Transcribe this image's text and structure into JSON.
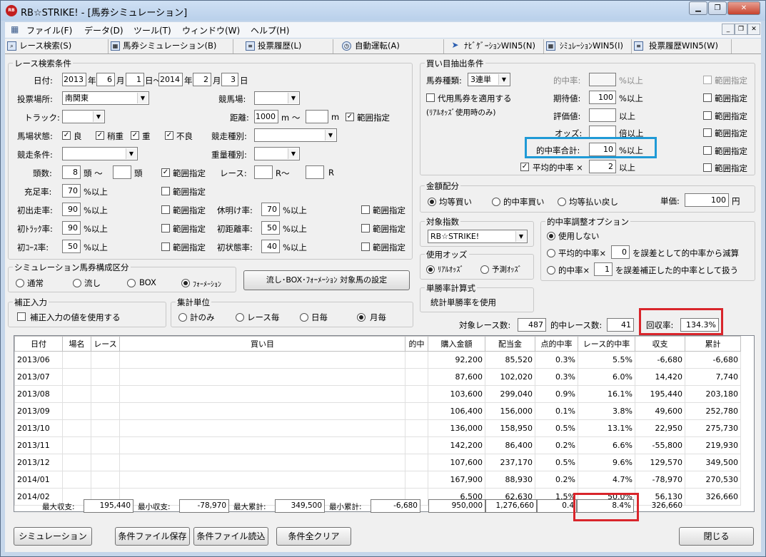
{
  "window": {
    "title": "RB☆STRIKE! - [馬券シミュレーション]",
    "icon_text": "RB"
  },
  "menu": [
    "ファイル(F)",
    "データ(D)",
    "ツール(T)",
    "ウィンドウ(W)",
    "ヘルプ(H)"
  ],
  "tabs": [
    "レース検索(S)",
    "馬券シミュレーション(B)",
    "投票履歴(L)",
    "自動運転(A)",
    "ﾅﾋﾞｹﾞｰｼｮﾝWIN5(N)",
    "ｼﾐｭﾚｰｼｮﾝWIN5(I)",
    "投票履歴WIN5(W)"
  ],
  "race": {
    "legend": "レース検索条件",
    "date_label": "日付:",
    "from_year": "2013",
    "year": "年",
    "from_month": "6",
    "month": "月",
    "from_day": "1",
    "day_range": "日〜",
    "to_year": "2014",
    "to_month": "2",
    "to_day": "3",
    "day": "日",
    "venue_label": "投票場所:",
    "venue": "南関東",
    "track_label": "競馬場:",
    "course_label": "トラック:",
    "distance_label": "距離:",
    "distance_from": "1000",
    "m_range": "m 〜",
    "m": "m",
    "range": "範囲指定",
    "condition_label": "馬場状態:",
    "good": "良",
    "slightly_heavy": "稍重",
    "heavy": "重",
    "bad": "不良",
    "race_type_label": "競走種別:",
    "race_cond_label": "競走条件:",
    "weight_label": "重量種別:",
    "heads_label": "頭数:",
    "heads_from": "8",
    "heads_range": "頭 〜",
    "heads": "頭",
    "race_label": "レース:",
    "r_range": "R〜",
    "r": "R",
    "fill_label": "充足率:",
    "fill": "70",
    "pct_over": "%以上",
    "first_run_label": "初出走率:",
    "first_run": "90",
    "rest_label": "休明け率:",
    "rest": "70",
    "first_track_label": "初ﾄﾗｯｸ率:",
    "first_track": "90",
    "first_dist_label": "初距離率:",
    "first_dist": "50",
    "first_course_label": "初ｺｰｽ率:",
    "first_course": "50",
    "first_state_label": "初状態率:",
    "first_state": "40"
  },
  "compose": {
    "legend": "シミュレーション馬券構成区分",
    "normal": "通常",
    "nagashi": "流し",
    "box": "BOX",
    "formation": "ﾌｫｰﾒｰｼｮﾝ",
    "settings_button": "流し･BOX･ﾌｫｰﾒｰｼｮﾝ 対象馬の設定"
  },
  "correction": {
    "legend": "補正入力",
    "use": "補正入力の値を使用する"
  },
  "unit": {
    "legend": "集計単位",
    "total": "計のみ",
    "race": "レース毎",
    "day": "日毎",
    "month": "月毎"
  },
  "buy": {
    "legend": "買い目抽出条件",
    "type_label": "馬券種類:",
    "type": "3連単",
    "proxy": "代用馬券を適用する",
    "proxy_note": "(ﾘｱﾙｵｯｽﾞ使用時のみ)",
    "hit_label": "的中率:",
    "pct_over": "%以上",
    "expect_label": "期待値:",
    "expect": "100",
    "eval_label": "評価値:",
    "over": "以上",
    "odds_label": "オッズ:",
    "odds_over": "倍以上",
    "sum_label": "的中率合計:",
    "sum": "10",
    "avg_label": "平均的中率 ×",
    "avg": "2",
    "range": "範囲指定"
  },
  "money": {
    "legend": "金額配分",
    "equal_buy": "均等買い",
    "hit_buy": "的中率買い",
    "equal_return": "均等払い戻し",
    "unit_label": "単価:",
    "unit": "100",
    "yen": "円"
  },
  "target": {
    "legend": "対象指数",
    "value": "RB☆STRIKE!"
  },
  "odds": {
    "legend": "使用オッズ",
    "real": "ﾘｱﾙｵｯｽﾞ",
    "forecast": "予測ｵｯｽﾞ"
  },
  "win": {
    "legend": "単勝率計算式",
    "text": "統計単勝率を使用"
  },
  "adjust": {
    "legend": "的中率調整オプション",
    "none": "使用しない",
    "opt1_a": "平均的中率×",
    "opt1_v": "0",
    "opt1_b": "を誤差として的中率から減算",
    "opt2_a": "的中率×",
    "opt2_v": "1",
    "opt2_b": "を誤差補正した的中率として扱う"
  },
  "stats": {
    "target_label": "対象レース数:",
    "target": "487",
    "hit_label": "的中レース数:",
    "hit": "41",
    "return_label": "回収率:",
    "return": "134.3%"
  },
  "table": {
    "headers": [
      "日付",
      "場名",
      "レース",
      "買い目",
      "的中",
      "購入金額",
      "配当金",
      "点的中率",
      "レース的中率",
      "収支",
      "累計"
    ],
    "rows": [
      [
        "2013/06",
        "",
        "",
        "",
        "",
        "92,200",
        "85,520",
        "0.3%",
        "5.5%",
        "-6,680",
        "-6,680"
      ],
      [
        "2013/07",
        "",
        "",
        "",
        "",
        "87,600",
        "102,020",
        "0.3%",
        "6.0%",
        "14,420",
        "7,740"
      ],
      [
        "2013/08",
        "",
        "",
        "",
        "",
        "103,600",
        "299,040",
        "0.9%",
        "16.1%",
        "195,440",
        "203,180"
      ],
      [
        "2013/09",
        "",
        "",
        "",
        "",
        "106,400",
        "156,000",
        "0.1%",
        "3.8%",
        "49,600",
        "252,780"
      ],
      [
        "2013/10",
        "",
        "",
        "",
        "",
        "136,000",
        "158,950",
        "0.5%",
        "13.1%",
        "22,950",
        "275,730"
      ],
      [
        "2013/11",
        "",
        "",
        "",
        "",
        "142,200",
        "86,400",
        "0.2%",
        "6.6%",
        "-55,800",
        "219,930"
      ],
      [
        "2013/12",
        "",
        "",
        "",
        "",
        "107,600",
        "237,170",
        "0.5%",
        "9.6%",
        "129,570",
        "349,500"
      ],
      [
        "2014/01",
        "",
        "",
        "",
        "",
        "167,900",
        "88,930",
        "0.2%",
        "4.7%",
        "-78,970",
        "270,530"
      ],
      [
        "2014/02",
        "",
        "",
        "",
        "",
        "6,500",
        "62,630",
        "1.5%",
        "50.0%",
        "56,130",
        "326,660"
      ]
    ]
  },
  "summary": {
    "max_label": "最大収支:",
    "max": "195,440",
    "min_label": "最小収支:",
    "min": "-78,970",
    "max_cum_label": "最大累計:",
    "max_cum": "349,500",
    "min_cum_label": "最小累計:",
    "min_cum": "-6,680",
    "buy": "950,000",
    "pay": "1,276,660",
    "point": "0.4",
    "race": "8.4%",
    "total": "326,660"
  },
  "buttons": {
    "simulate": "シミュレーション",
    "save": "条件ファイル保存",
    "load": "条件ファイル読込",
    "clear": "条件全クリア",
    "close": "閉じる"
  }
}
